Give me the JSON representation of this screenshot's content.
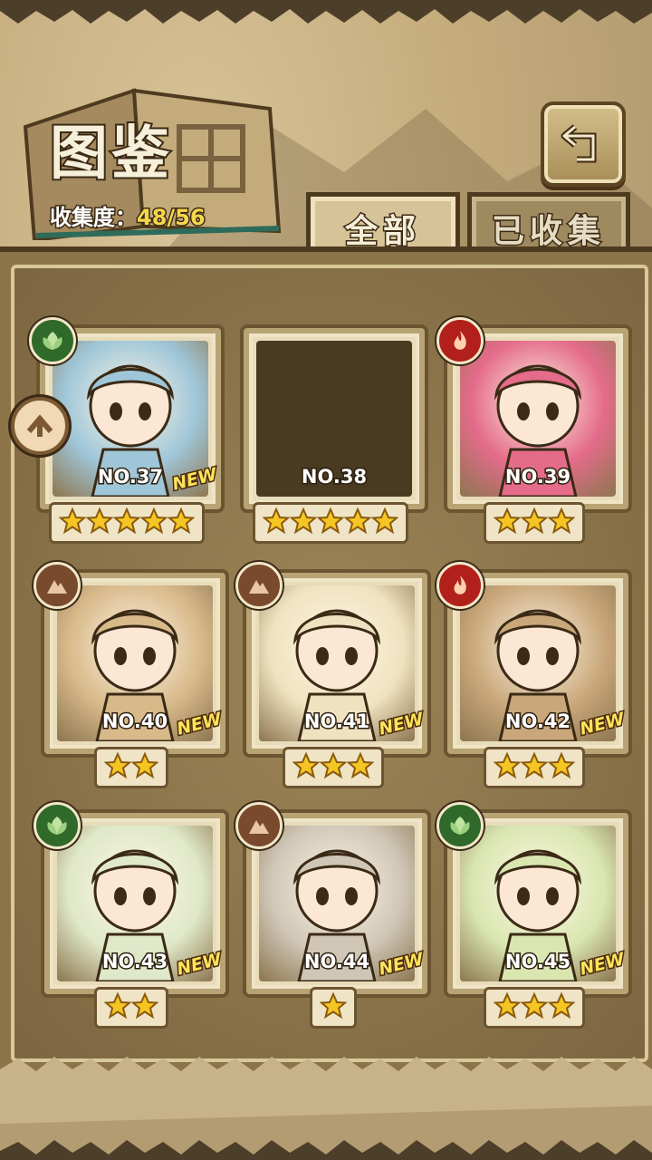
{
  "header": {
    "title": "图鉴",
    "collection_label": "收集度：",
    "collection_value": "48/56"
  },
  "tabs": [
    {
      "label": "全部",
      "active": true
    },
    {
      "label": "已收集",
      "active": false
    }
  ],
  "colors": {
    "leaf": "#2f6a2a",
    "fire": "#b2201b",
    "earth": "#7a4a2c",
    "star": "#f5c523"
  },
  "cards": [
    {
      "no": "NO.37",
      "element": "leaf",
      "stars": 5,
      "is_new": true,
      "new_label": "NEW",
      "collected": true,
      "art_color": "#9fc6d8"
    },
    {
      "no": "NO.38",
      "element": "",
      "stars": 5,
      "is_new": false,
      "new_label": "",
      "collected": false,
      "art_color": "#4a3a22"
    },
    {
      "no": "NO.39",
      "element": "fire",
      "stars": 3,
      "is_new": false,
      "new_label": "",
      "collected": true,
      "art_color": "#e46b8a"
    },
    {
      "no": "NO.40",
      "element": "earth",
      "stars": 2,
      "is_new": true,
      "new_label": "NEW",
      "collected": true,
      "art_color": "#d8b98a"
    },
    {
      "no": "NO.41",
      "element": "earth",
      "stars": 3,
      "is_new": true,
      "new_label": "NEW",
      "collected": true,
      "art_color": "#f0e2c0"
    },
    {
      "no": "NO.42",
      "element": "fire",
      "stars": 3,
      "is_new": true,
      "new_label": "NEW",
      "collected": true,
      "art_color": "#c9a77a"
    },
    {
      "no": "NO.43",
      "element": "leaf",
      "stars": 2,
      "is_new": true,
      "new_label": "NEW",
      "collected": true,
      "art_color": "#dfe8c8"
    },
    {
      "no": "NO.44",
      "element": "earth",
      "stars": 1,
      "is_new": true,
      "new_label": "NEW",
      "collected": true,
      "art_color": "#cfc6b6"
    },
    {
      "no": "NO.45",
      "element": "leaf",
      "stars": 3,
      "is_new": true,
      "new_label": "NEW",
      "collected": true,
      "art_color": "#d9e6b0"
    }
  ]
}
